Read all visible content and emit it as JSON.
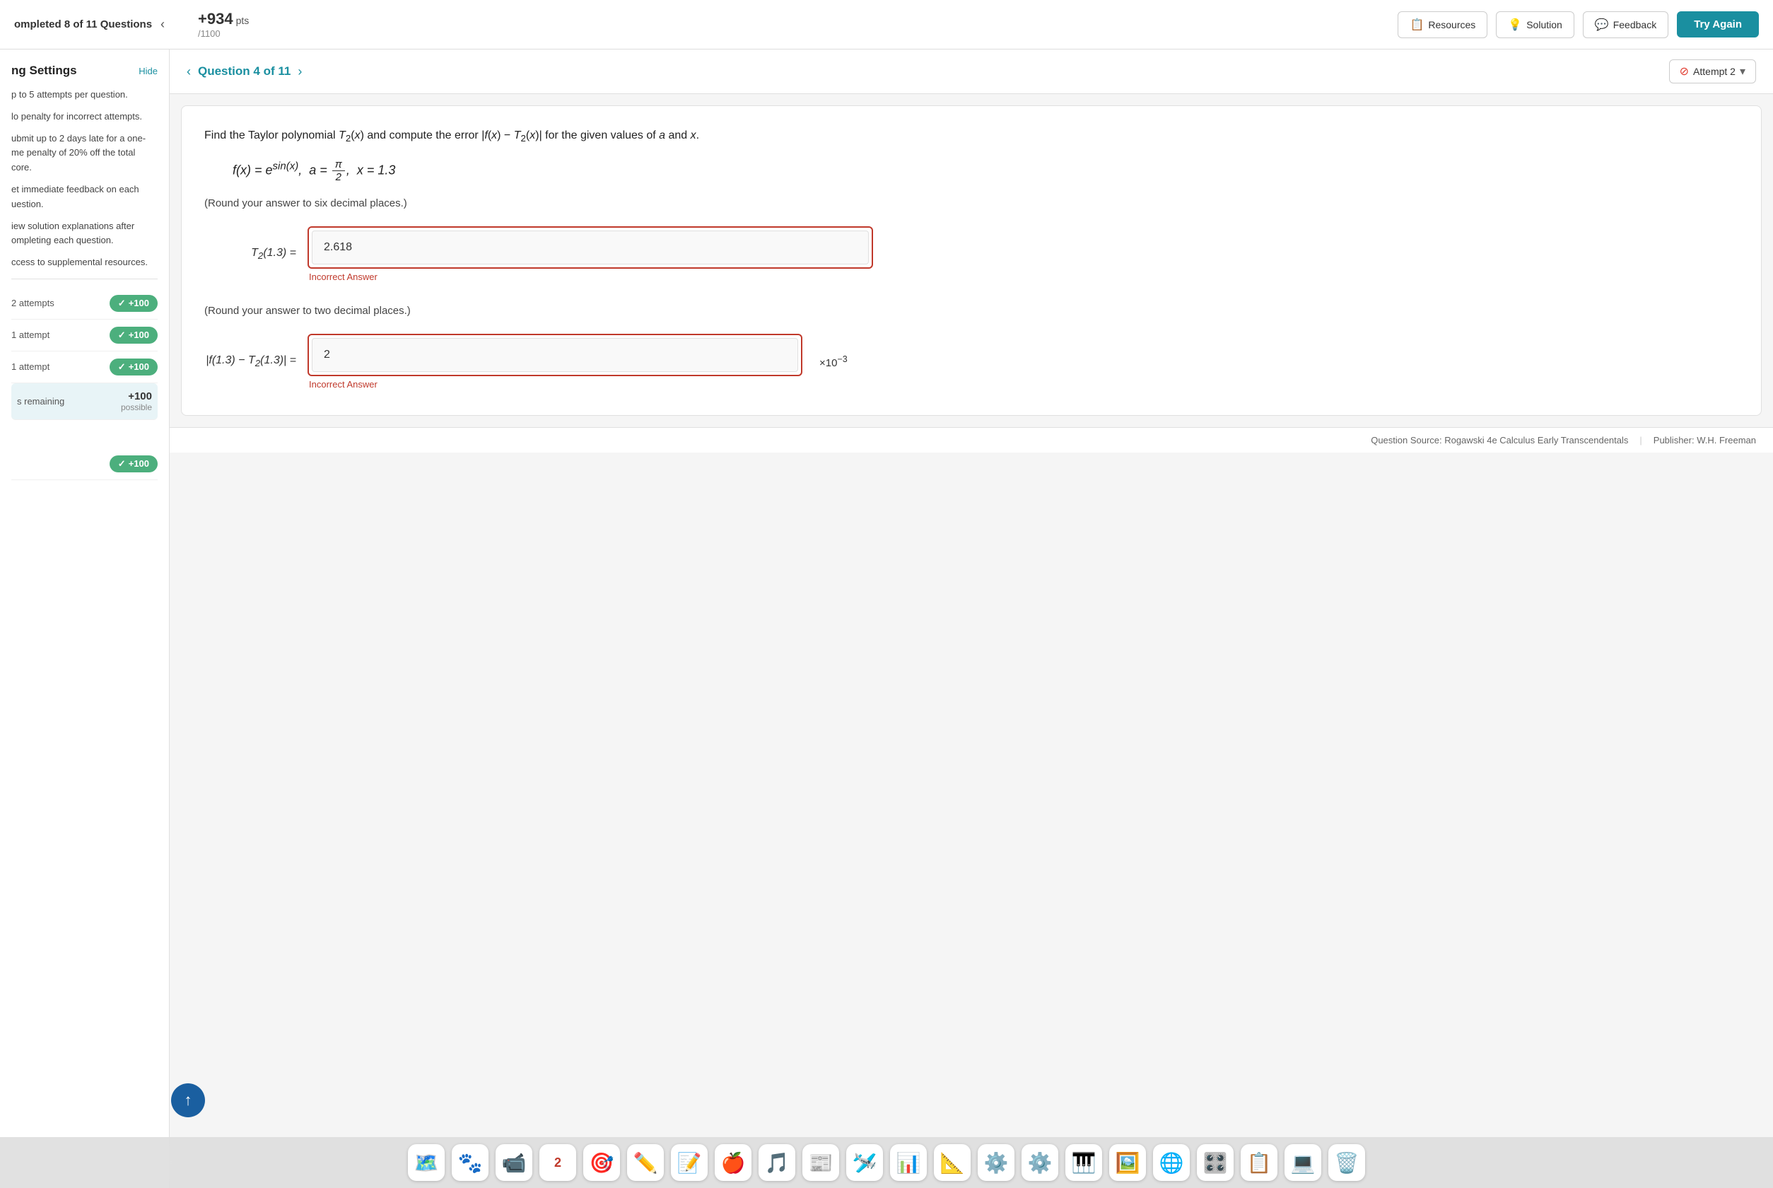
{
  "topbar": {
    "completed_label": "ompleted 8 of 11 Questions",
    "pts_value": "+934",
    "pts_unit": "pts",
    "pts_total": "/1100",
    "resources_label": "Resources",
    "solution_label": "Solution",
    "feedback_label": "Feedback",
    "try_again_label": "Try Again"
  },
  "sidebar": {
    "title": "ng Settings",
    "hide_label": "Hide",
    "rules": [
      {
        "text": "p to 5 attempts per question."
      },
      {
        "text": "lo penalty for incorrect attempts."
      },
      {
        "text": "ubmit up to 2 days late for a one-me penalty of 20% off the total core."
      },
      {
        "text": "et immediate feedback on each uestion."
      },
      {
        "text": "iew solution explanations after ompleting each question."
      },
      {
        "text": "ccess to supplemental resources."
      }
    ],
    "score_rows": [
      {
        "label": "2 attempts",
        "badge": "+100",
        "active": false
      },
      {
        "label": "1 attempt",
        "badge": "+100",
        "active": false
      },
      {
        "label": "1 attempt",
        "badge": "+100",
        "active": false
      },
      {
        "label": "s remaining",
        "badge_big": "+100",
        "badge_small": "possible",
        "active": true
      }
    ]
  },
  "question_nav": {
    "label": "Question 4 of 11",
    "attempt_label": "Attempt 2"
  },
  "question": {
    "intro": "Find the Taylor polynomial T₂(x) and compute the error |f(x) − T₂(x)| for the given values of a and x.",
    "formula_display": "f(x) = e^sin(x), a = π/2, x = 1.3",
    "round_note_1": "(Round your answer to six decimal places.)",
    "answer1_label": "T₂(1.3) =",
    "answer1_value": "2.618",
    "answer1_incorrect": "Incorrect Answer",
    "round_note_2": "(Round your answer to two decimal places.)",
    "answer2_label": "|f(1.3) − T₂(1.3)| =",
    "answer2_value": "2",
    "answer2_suffix": "×10⁻³",
    "answer2_incorrect": "Incorrect Answer"
  },
  "bottom_bar": {
    "source": "Question Source: Rogawski 4e Calculus Early Transcendentals",
    "sep": "|",
    "publisher": "Publisher: W.H. Freeman"
  },
  "dock": {
    "icons": [
      "🗺️",
      "🐾",
      "📹",
      "2",
      "🎯",
      "✏️",
      "📝",
      "🍎",
      "🎵",
      "📰",
      "🛩️",
      "📊",
      "📐",
      "⚙️",
      "🔵",
      "🎹",
      "🖼️",
      "🌐",
      "🎛️",
      "📋",
      "💻",
      "🗑️"
    ]
  }
}
